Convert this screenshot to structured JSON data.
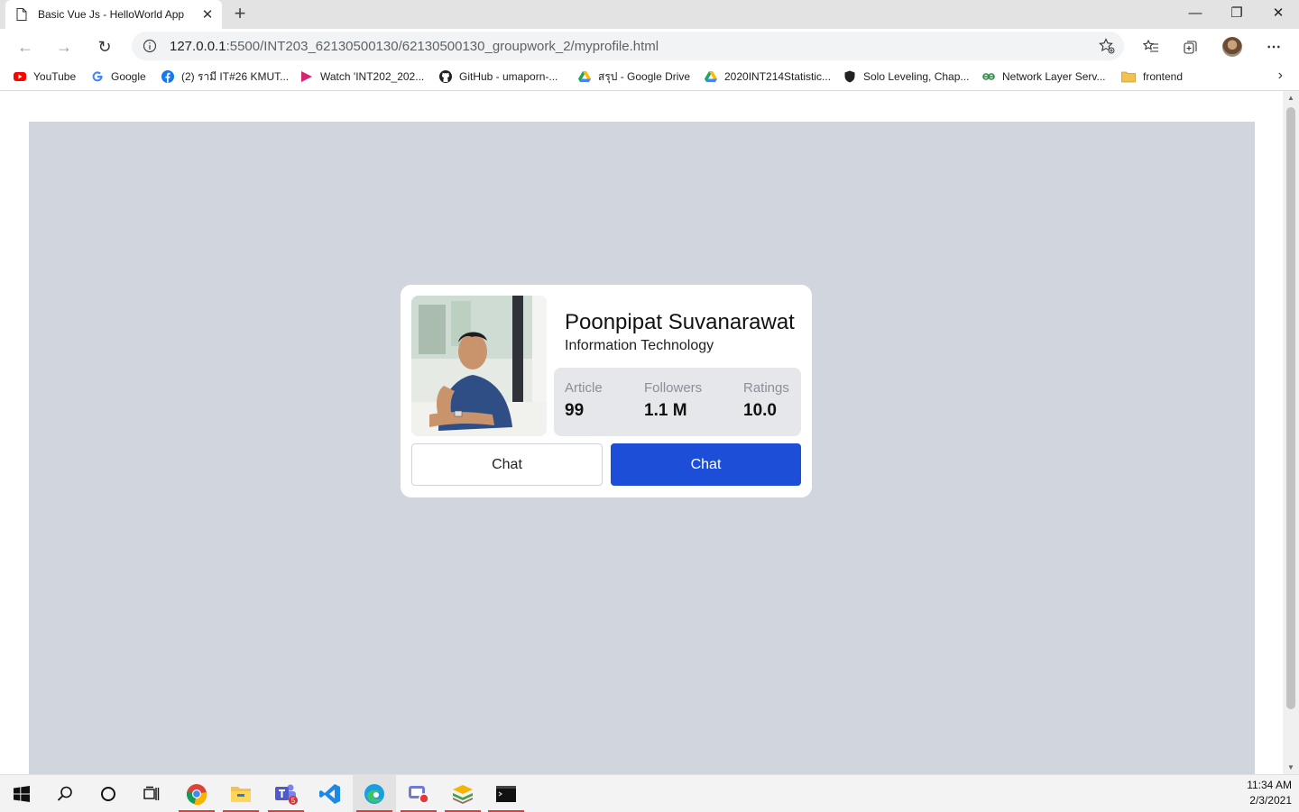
{
  "browser": {
    "tab_title": "Basic Vue Js - HelloWorld App",
    "tab_close": "✕",
    "new_tab": "+",
    "window_controls": {
      "minimize": "—",
      "restore": "❐",
      "close": "✕"
    },
    "url_host": "127.0.0.1",
    "url_rest": ":5500/INT203_62130500130/62130500130_groupwork_2/myprofile.html",
    "bookmarks": [
      {
        "label": "YouTube",
        "icon": "youtube-icon",
        "color": "#ff0000"
      },
      {
        "label": "Google",
        "icon": "google-icon",
        "color": "#4285f4"
      },
      {
        "label": "(2) รามี IT#26 KMUT...",
        "icon": "facebook-icon",
        "color": "#1877f2"
      },
      {
        "label": "Watch 'INT202_202...",
        "icon": "play-icon",
        "color": "#d6246e"
      },
      {
        "label": "GitHub - umaporn-...",
        "icon": "github-icon",
        "color": "#222222"
      },
      {
        "label": "สรุป - Google Drive",
        "icon": "drive-icon",
        "color": "#1fa463"
      },
      {
        "label": "2020INT214Statistic...",
        "icon": "drive-icon",
        "color": "#1fa463"
      },
      {
        "label": "Solo Leveling, Chap...",
        "icon": "shield-icon",
        "color": "#222222"
      },
      {
        "label": "Network Layer Serv...",
        "icon": "gfg-icon",
        "color": "#2f8d46"
      },
      {
        "label": "frontend",
        "icon": "folder-icon",
        "color": "#f2c14e"
      }
    ]
  },
  "profile": {
    "name": "Poonpipat Suvanarawat",
    "department": "Information Technology",
    "stats": [
      {
        "label": "Article",
        "value": "99"
      },
      {
        "label": "Followers",
        "value": "1.1 M"
      },
      {
        "label": "Ratings",
        "value": "10.0"
      }
    ],
    "buttons": {
      "outline": "Chat",
      "primary": "Chat"
    }
  },
  "taskbar": {
    "time": "11:34 AM",
    "date": "2/3/2021",
    "teams_badge": "5"
  }
}
